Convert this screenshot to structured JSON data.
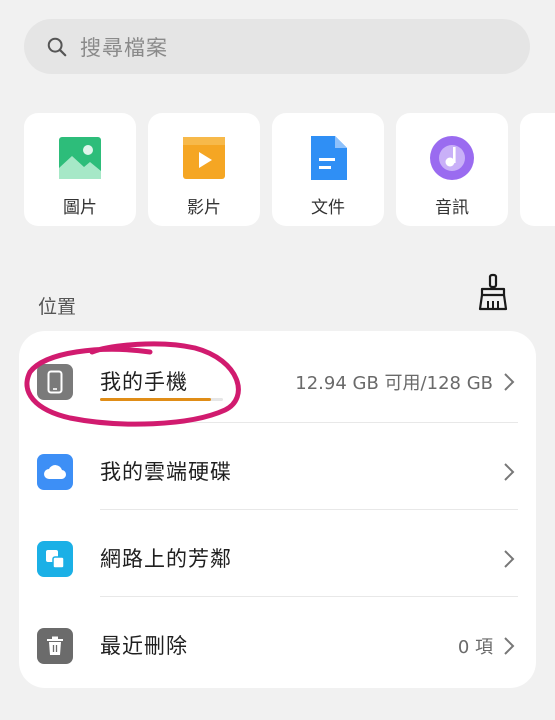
{
  "search": {
    "placeholder": "搜尋檔案"
  },
  "categories": [
    {
      "label": "圖片",
      "icon": "image-icon",
      "color": "#2dbd7a"
    },
    {
      "label": "影片",
      "icon": "video-icon",
      "color": "#f5a623"
    },
    {
      "label": "文件",
      "icon": "document-icon",
      "color": "#2f8ff5"
    },
    {
      "label": "音訊",
      "icon": "audio-icon",
      "color": "#9a6bf0"
    }
  ],
  "locations": {
    "title": "位置",
    "items": [
      {
        "label": "我的手機",
        "value": "12.94 GB 可用/128 GB",
        "icon": "phone-icon",
        "color": "#7a7a7a",
        "storage_used_fraction": 0.9
      },
      {
        "label": "我的雲端硬碟",
        "value": "",
        "icon": "cloud-icon",
        "color": "#3d8ff6"
      },
      {
        "label": "網路上的芳鄰",
        "value": "",
        "icon": "network-icon",
        "color": "#1bb0e6"
      },
      {
        "label": "最近刪除",
        "value": "0 項",
        "icon": "trash-icon",
        "color": "#6b6b6b"
      }
    ]
  },
  "colors": {
    "annotation": "#d11b6f",
    "storage": "#e08d17"
  }
}
